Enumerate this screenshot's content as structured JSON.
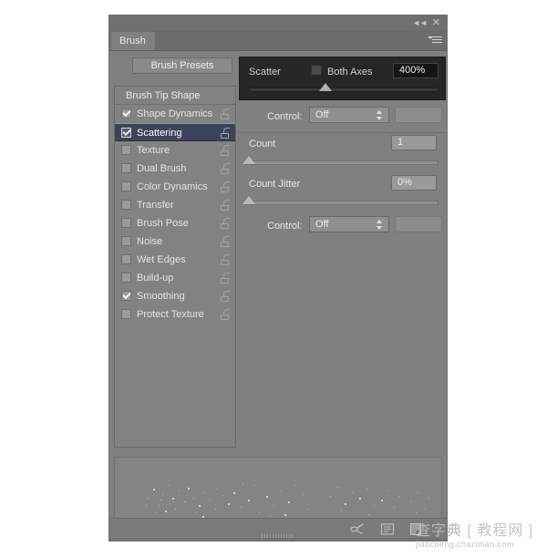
{
  "window": {
    "title": "Brush",
    "collapse_icon": "double-chevron-left-icon",
    "close_icon": "close-icon",
    "menu_icon": "panel-menu-icon"
  },
  "tabs": [
    {
      "label": "Brush",
      "active": true
    }
  ],
  "left": {
    "presets_button": "Brush Presets",
    "list_header": "Brush Tip Shape",
    "options": [
      {
        "label": "Shape Dynamics",
        "checked": true,
        "selected": false,
        "locked": false
      },
      {
        "label": "Scattering",
        "checked": true,
        "selected": true,
        "locked": false
      },
      {
        "label": "Texture",
        "checked": false,
        "selected": false,
        "locked": false
      },
      {
        "label": "Dual Brush",
        "checked": false,
        "selected": false,
        "locked": false
      },
      {
        "label": "Color Dynamics",
        "checked": false,
        "selected": false,
        "locked": false
      },
      {
        "label": "Transfer",
        "checked": false,
        "selected": false,
        "locked": false
      },
      {
        "label": "Brush Pose",
        "checked": false,
        "selected": false,
        "locked": false
      },
      {
        "label": "Noise",
        "checked": false,
        "selected": false,
        "locked": false
      },
      {
        "label": "Wet Edges",
        "checked": false,
        "selected": false,
        "locked": false
      },
      {
        "label": "Build-up",
        "checked": false,
        "selected": false,
        "locked": false
      },
      {
        "label": "Smoothing",
        "checked": true,
        "selected": false,
        "locked": false
      },
      {
        "label": "Protect Texture",
        "checked": false,
        "selected": false,
        "locked": false
      }
    ]
  },
  "right": {
    "scatter": {
      "label": "Scatter",
      "both_axes_label": "Both Axes",
      "both_axes_checked": false,
      "value": "400%",
      "slider_percent": 40
    },
    "scatter_control": {
      "label": "Control:",
      "value": "Off"
    },
    "count": {
      "label": "Count",
      "value": "1",
      "slider_percent": 0
    },
    "count_jitter": {
      "label": "Count Jitter",
      "value": "0%",
      "slider_percent": 0
    },
    "jitter_control": {
      "label": "Control:",
      "value": "Off"
    }
  },
  "footer": {
    "icons": [
      {
        "name": "brush-stroke-icon"
      },
      {
        "name": "new-brush-preset-icon"
      },
      {
        "name": "new-document-icon"
      }
    ]
  },
  "preview": {
    "dots": [
      [
        42,
        34,
        2
      ],
      [
        52,
        40,
        1
      ],
      [
        58,
        30,
        1
      ],
      [
        63,
        44,
        2
      ],
      [
        70,
        36,
        1
      ],
      [
        76,
        48,
        1
      ],
      [
        48,
        52,
        1
      ],
      [
        55,
        58,
        2
      ],
      [
        66,
        56,
        1
      ],
      [
        80,
        33,
        2
      ],
      [
        86,
        44,
        1
      ],
      [
        92,
        52,
        2
      ],
      [
        98,
        38,
        1
      ],
      [
        104,
        46,
        1
      ],
      [
        88,
        60,
        1
      ],
      [
        96,
        64,
        2
      ],
      [
        110,
        56,
        1
      ],
      [
        118,
        41,
        1
      ],
      [
        124,
        50,
        2
      ],
      [
        112,
        34,
        1
      ],
      [
        130,
        38,
        2
      ],
      [
        138,
        54,
        1
      ],
      [
        146,
        46,
        2
      ],
      [
        152,
        30,
        1
      ],
      [
        158,
        60,
        1
      ],
      [
        140,
        28,
        1
      ],
      [
        166,
        42,
        2
      ],
      [
        174,
        52,
        1
      ],
      [
        182,
        36,
        1
      ],
      [
        190,
        48,
        2
      ],
      [
        198,
        30,
        1
      ],
      [
        206,
        40,
        1
      ],
      [
        212,
        56,
        1
      ],
      [
        170,
        64,
        1
      ],
      [
        186,
        62,
        2
      ],
      [
        236,
        42,
        1
      ],
      [
        244,
        32,
        1
      ],
      [
        252,
        50,
        2
      ],
      [
        260,
        38,
        1
      ],
      [
        248,
        58,
        1
      ],
      [
        268,
        44,
        2
      ],
      [
        276,
        34,
        1
      ],
      [
        284,
        52,
        1
      ],
      [
        292,
        46,
        2
      ],
      [
        300,
        36,
        1
      ],
      [
        278,
        62,
        1
      ],
      [
        290,
        66,
        1
      ],
      [
        306,
        54,
        1
      ],
      [
        312,
        42,
        1
      ],
      [
        324,
        48,
        1
      ],
      [
        332,
        38,
        1
      ],
      [
        340,
        56,
        1
      ],
      [
        330,
        60,
        1
      ],
      [
        344,
        44,
        1
      ],
      [
        72,
        72,
        2
      ],
      [
        108,
        74,
        2
      ],
      [
        196,
        72,
        1
      ],
      [
        228,
        76,
        1
      ],
      [
        244,
        70,
        2
      ],
      [
        286,
        70,
        1
      ],
      [
        300,
        74,
        1
      ],
      [
        318,
        68,
        1
      ],
      [
        322,
        76,
        1
      ],
      [
        36,
        44,
        1
      ],
      [
        34,
        52,
        1
      ],
      [
        44,
        60,
        1
      ],
      [
        50,
        46,
        1
      ],
      [
        60,
        50,
        1
      ]
    ]
  },
  "watermark": {
    "main": "查字典",
    "brackets": "[ 教程网 ]",
    "sub": "jiaocheng.chazidian.com"
  }
}
